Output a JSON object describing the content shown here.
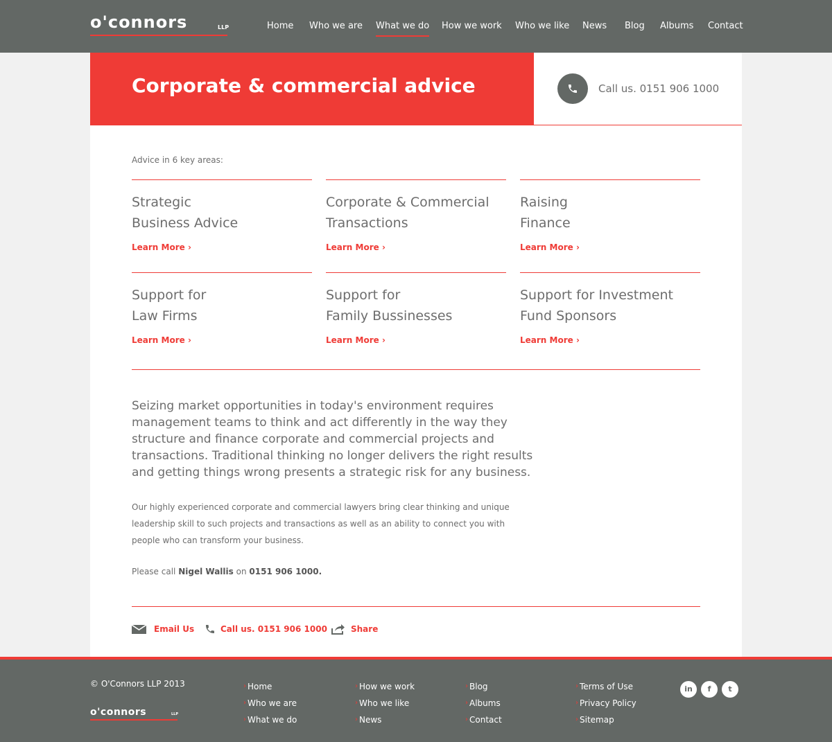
{
  "brand": {
    "logo_text": "o'connors",
    "logo_suffix": "LLP"
  },
  "nav": {
    "items": [
      "Home",
      "Who we are",
      "What we do",
      "How we work",
      "Who we like",
      "News",
      "Blog",
      "Albums",
      "Contact"
    ],
    "active": "What we do"
  },
  "hero": {
    "title": "Corporate & commercial advice",
    "call": "Call us. 0151 906 1000"
  },
  "intro": "Advice in 6 key areas:",
  "areas": [
    {
      "line1": "Strategic",
      "line2": "Business Advice",
      "link": "Learn More ›"
    },
    {
      "line1": "Corporate & Commercial",
      "line2": "Transactions",
      "link": "Learn More ›"
    },
    {
      "line1": "Raising",
      "line2": "Finance",
      "link": "Learn More ›"
    },
    {
      "line1": "Support for",
      "line2": "Law Firms",
      "link": "Learn More ›"
    },
    {
      "line1": "Support for",
      "line2": "Family Bussinesses",
      "link": "Learn More ›"
    },
    {
      "line1": "Support for Investment",
      "line2": "Fund Sponsors",
      "link": "Learn More ›"
    }
  ],
  "lead": "Seizing market opportunities in today's environment requires management teams to think and act differently in the way they structure and finance corporate and commercial projects and transactions. Traditional thinking no longer delivers the right results and getting things wrong presents a strategic risk for any business.",
  "body": "Our highly experienced corporate and commercial lawyers bring clear thinking and unique leadership skill to such projects and transactions as well as an ability to connect you with people who can transform your business.",
  "contact": {
    "prefix": "Please call",
    "name": "Nigel Wallis",
    "on": "on",
    "phone": "0151 906 1000."
  },
  "actions": {
    "email": "Email Us",
    "call": "Call us. 0151 906 1000",
    "share": "Share"
  },
  "footer": {
    "copyright": "© O'Connors LLP 2013",
    "col1": [
      "Home",
      "Who we are",
      "What we do"
    ],
    "col2": [
      "How we work",
      "Who we like",
      "News"
    ],
    "col3": [
      "Blog",
      "Albums",
      "Contact"
    ],
    "col4": [
      "Terms of Use",
      "Privacy Policy",
      "Sitemap"
    ],
    "social": {
      "linkedin": "in",
      "facebook": "f",
      "twitter": "t"
    }
  },
  "colors": {
    "accent": "#ef3b36",
    "header_bg": "#636865",
    "text": "#6d6d6d"
  }
}
